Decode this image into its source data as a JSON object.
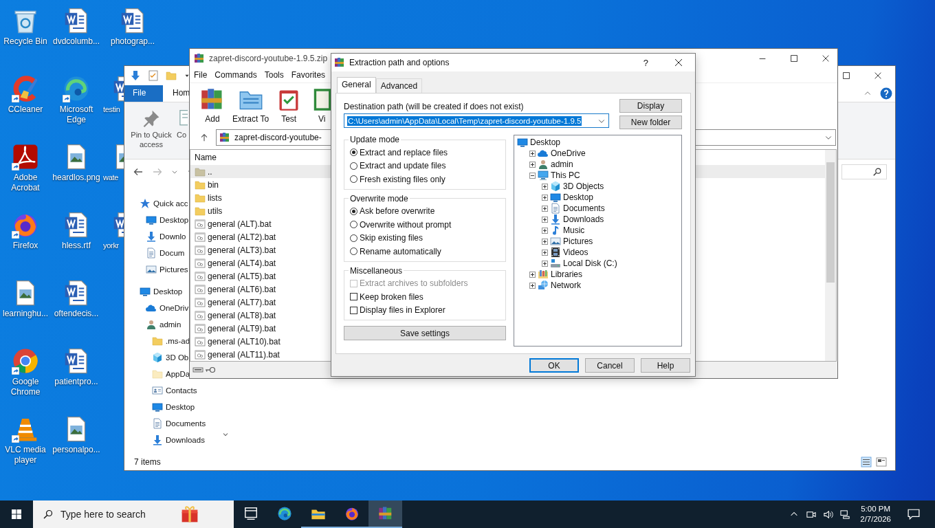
{
  "desktop": {
    "icon_columns": [
      {
        "icons": [
          {
            "label": "Recycle Bin",
            "kind": "recycle",
            "shortcut": false
          },
          {
            "label": "CCleaner",
            "kind": "ccleaner",
            "shortcut": true
          },
          {
            "label": "Adobe Acrobat",
            "kind": "acrobat",
            "shortcut": true
          },
          {
            "label": "Firefox",
            "kind": "firefox",
            "shortcut": true
          },
          {
            "label": "learninghu...",
            "kind": "image",
            "shortcut": false
          },
          {
            "label": "Google Chrome",
            "kind": "chrome",
            "shortcut": true
          },
          {
            "label": "VLC media player",
            "kind": "vlc",
            "shortcut": true
          }
        ]
      },
      {
        "icons": [
          {
            "label": "dvdcolumb...",
            "kind": "word",
            "shortcut": false
          },
          {
            "label": "Microsoft Edge",
            "kind": "edge",
            "shortcut": true
          },
          {
            "label": "heardlos.png",
            "kind": "image",
            "shortcut": false
          },
          {
            "label": "hless.rtf",
            "kind": "word",
            "shortcut": false
          },
          {
            "label": "oftendecis...",
            "kind": "word",
            "shortcut": false
          },
          {
            "label": "patientpro...",
            "kind": "word",
            "shortcut": false
          },
          {
            "label": "personalpo...",
            "kind": "image",
            "shortcut": false
          }
        ]
      },
      {
        "icons": [
          {
            "label": "photograp...",
            "kind": "word",
            "shortcut": false
          },
          {
            "label": "testin",
            "kind": "word",
            "shortcut": false
          },
          {
            "label": "wate",
            "kind": "image",
            "shortcut": false
          },
          {
            "label": "yorkr",
            "kind": "word",
            "shortcut": false
          }
        ]
      }
    ]
  },
  "explorer": {
    "ribbon_tabs": [
      {
        "label": "File",
        "kind": "file"
      },
      {
        "label": "Hom",
        "kind": "tab"
      }
    ],
    "ribbon_commands": [
      {
        "label": "Pin to Quick access",
        "kind": "pin"
      },
      {
        "label": "Co",
        "kind": "copy"
      }
    ],
    "nav": [
      {
        "label": "Quick acc",
        "kind": "star",
        "children": [
          {
            "label": "Desktop",
            "kind": "monitor"
          },
          {
            "label": "Downlo",
            "kind": "download"
          },
          {
            "label": "Docum",
            "kind": "document"
          },
          {
            "label": "Pictures",
            "kind": "picture"
          }
        ]
      },
      {
        "label": "Desktop",
        "kind": "monitor",
        "children": [
          {
            "label": "OneDriv",
            "kind": "cloud"
          },
          {
            "label": "admin",
            "kind": "user",
            "children": [
              {
                "label": ".ms-ad",
                "kind": "folder"
              },
              {
                "label": "3D Ob",
                "kind": "cube"
              },
              {
                "label": "AppDa",
                "kind": "folderpale"
              },
              {
                "label": "Contacts",
                "kind": "contacts"
              },
              {
                "label": "Desktop",
                "kind": "monitor"
              },
              {
                "label": "Documents",
                "kind": "document"
              },
              {
                "label": "Downloads",
                "kind": "download"
              }
            ]
          }
        ]
      }
    ],
    "status": "7 items"
  },
  "winrar": {
    "title": "zapret-discord-youtube-1.9.5.zip",
    "menu": [
      "File",
      "Commands",
      "Tools",
      "Favorites"
    ],
    "toolbar": [
      {
        "label": "Add",
        "kind": "add"
      },
      {
        "label": "Extract To",
        "kind": "extract"
      },
      {
        "label": "Test",
        "kind": "test"
      },
      {
        "label": "Vi",
        "kind": "view"
      }
    ],
    "address": "zapret-discord-youtube-",
    "list": {
      "columns": [
        "Name"
      ],
      "rows": [
        {
          "name": "..",
          "kind": "up",
          "selected": true
        },
        {
          "name": "bin",
          "kind": "folder",
          "selected": false
        },
        {
          "name": "lists",
          "kind": "folder",
          "selected": false
        },
        {
          "name": "utils",
          "kind": "folder",
          "selected": false
        },
        {
          "name": "general (ALT).bat",
          "kind": "bat",
          "selected": false
        },
        {
          "name": "general (ALT2).bat",
          "kind": "bat",
          "selected": false
        },
        {
          "name": "general (ALT3).bat",
          "kind": "bat",
          "selected": false
        },
        {
          "name": "general (ALT4).bat",
          "kind": "bat",
          "selected": false
        },
        {
          "name": "general (ALT5).bat",
          "kind": "bat",
          "selected": false
        },
        {
          "name": "general (ALT6).bat",
          "kind": "bat",
          "selected": false
        },
        {
          "name": "general (ALT7).bat",
          "kind": "bat",
          "selected": false
        },
        {
          "name": "general (ALT8).bat",
          "kind": "bat",
          "selected": false
        },
        {
          "name": "general (ALT9).bat",
          "kind": "bat",
          "selected": false
        },
        {
          "name": "general (ALT10).bat",
          "kind": "bat",
          "selected": false
        },
        {
          "name": "general (ALT11).bat",
          "kind": "bat",
          "selected": false
        }
      ]
    }
  },
  "dialog": {
    "title": "Extraction path and options",
    "help": "?",
    "tabs": [
      {
        "label": "General",
        "selected": true
      },
      {
        "label": "Advanced",
        "selected": false
      }
    ],
    "destination_label": "Destination path (will be created if does not exist)",
    "destination_value": "C:\\Users\\admin\\AppData\\Local\\Temp\\zapret-discord-youtube-1.9.5",
    "value_selected": true,
    "side_buttons": [
      "Display",
      "New folder"
    ],
    "groups": [
      {
        "title": "Update mode",
        "kind": "radio",
        "options": [
          {
            "label": "Extract and replace files",
            "selected": true
          },
          {
            "label": "Extract and update files",
            "selected": false
          },
          {
            "label": "Fresh existing files only",
            "selected": false
          }
        ]
      },
      {
        "title": "Overwrite mode",
        "kind": "radio",
        "options": [
          {
            "label": "Ask before overwrite",
            "selected": true
          },
          {
            "label": "Overwrite without prompt",
            "selected": false
          },
          {
            "label": "Skip existing files",
            "selected": false
          },
          {
            "label": "Rename automatically",
            "selected": false
          }
        ]
      },
      {
        "title": "Miscellaneous",
        "kind": "checkbox",
        "options": [
          {
            "label": "Extract archives to subfolders",
            "checked": false,
            "disabled": true
          },
          {
            "label": "Keep broken files",
            "checked": false,
            "disabled": false
          },
          {
            "label": "Display files in Explorer",
            "checked": false,
            "disabled": false
          }
        ]
      }
    ],
    "save_button": "Save settings",
    "tree": [
      {
        "label": "Desktop",
        "kind": "monitor",
        "children": [
          {
            "label": "OneDrive",
            "kind": "cloud",
            "expanded": false
          },
          {
            "label": "admin",
            "kind": "user",
            "expanded": false
          },
          {
            "label": "This PC",
            "kind": "pc",
            "expanded": true,
            "children": [
              {
                "label": "3D Objects",
                "kind": "cube",
                "expanded": false
              },
              {
                "label": "Desktop",
                "kind": "monitor",
                "expanded": false
              },
              {
                "label": "Documents",
                "kind": "document",
                "expanded": false
              },
              {
                "label": "Downloads",
                "kind": "download",
                "expanded": false
              },
              {
                "label": "Music",
                "kind": "music",
                "expanded": false
              },
              {
                "label": "Pictures",
                "kind": "picture",
                "expanded": false
              },
              {
                "label": "Videos",
                "kind": "film",
                "expanded": false
              },
              {
                "label": "Local Disk (C:)",
                "kind": "drive",
                "expanded": false
              }
            ]
          },
          {
            "label": "Libraries",
            "kind": "library",
            "expanded": false
          },
          {
            "label": "Network",
            "kind": "network",
            "expanded": false
          }
        ]
      }
    ],
    "buttons": [
      {
        "label": "OK",
        "default": true
      },
      {
        "label": "Cancel",
        "default": false
      },
      {
        "label": "Help",
        "default": false
      }
    ]
  },
  "taskbar": {
    "search_placeholder": "Type here to search",
    "apps": [
      {
        "kind": "taskview",
        "running": false,
        "active": false
      },
      {
        "kind": "edge",
        "running": false,
        "active": false
      },
      {
        "kind": "explorer",
        "running": true,
        "active": false
      },
      {
        "kind": "firefox",
        "running": true,
        "active": false
      },
      {
        "kind": "winrar",
        "running": true,
        "active": true
      }
    ],
    "time": "5:00 PM",
    "date": "2/7/2026"
  }
}
